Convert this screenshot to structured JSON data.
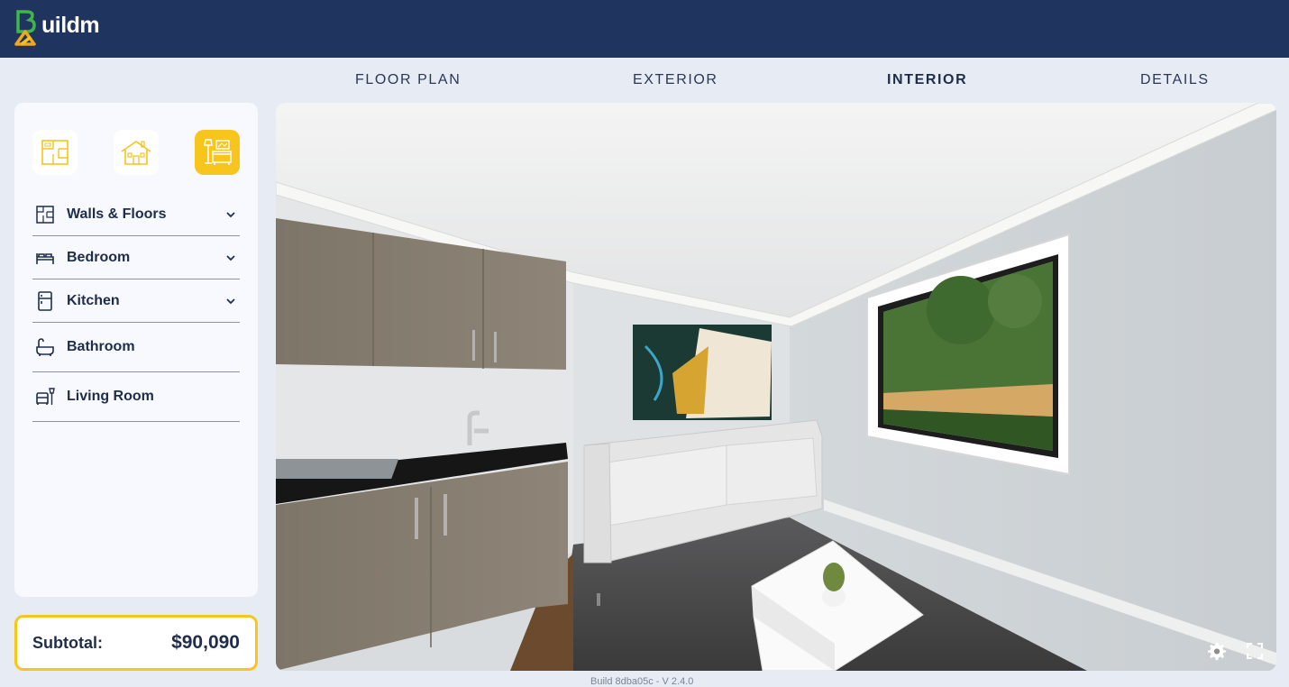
{
  "brand": {
    "name": "uildm",
    "mark_letter": "B"
  },
  "tabs": [
    {
      "label": "FLOOR PLAN",
      "active": false
    },
    {
      "label": "EXTERIOR",
      "active": false
    },
    {
      "label": "INTERIOR",
      "active": true
    },
    {
      "label": "DETAILS",
      "active": false
    }
  ],
  "mode_buttons": [
    {
      "icon": "floor-plan-icon",
      "active": false
    },
    {
      "icon": "house-exterior-icon",
      "active": false
    },
    {
      "icon": "interior-lamp-sofa-icon",
      "active": true
    }
  ],
  "menu": [
    {
      "label": "Walls & Floors",
      "icon": "walls-floors-icon",
      "expandable": true
    },
    {
      "label": "Bedroom",
      "icon": "bed-icon",
      "expandable": true
    },
    {
      "label": "Kitchen",
      "icon": "fridge-icon",
      "expandable": true
    },
    {
      "label": "Bathroom",
      "icon": "bathtub-icon",
      "expandable": false
    },
    {
      "label": "Living Room",
      "icon": "armchair-lamp-icon",
      "expandable": false
    }
  ],
  "subtotal": {
    "label": "Subtotal:",
    "value": "$90,090"
  },
  "version": "Build 8dba05c - V 2.4.0",
  "viewer": {
    "controls": [
      "settings-gear-icon",
      "fullscreen-icon"
    ]
  },
  "colors": {
    "header": "#1f3560",
    "accent": "#f7c51c",
    "background": "#e7ebf4",
    "text": "#1f2d4a"
  }
}
